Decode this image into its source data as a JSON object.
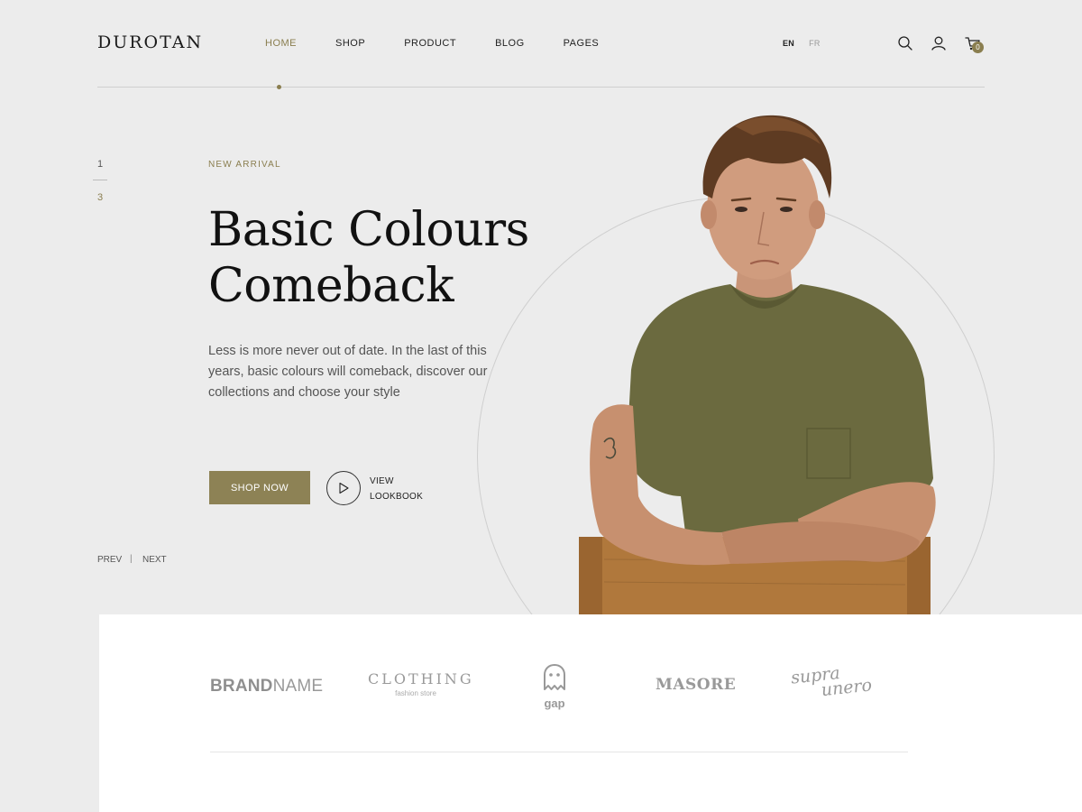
{
  "header": {
    "logo": "DUROTAN",
    "nav": [
      {
        "label": "HOME",
        "active": true
      },
      {
        "label": "SHOP",
        "active": false
      },
      {
        "label": "PRODUCT",
        "active": false
      },
      {
        "label": "BLOG",
        "active": false
      },
      {
        "label": "PAGES",
        "active": false
      }
    ],
    "languages": [
      "EN",
      "FR"
    ],
    "active_language": "EN",
    "icons": [
      "search-icon",
      "user-icon",
      "cart-icon"
    ],
    "cart_count": "0"
  },
  "slider": {
    "current": "1",
    "total": "3",
    "prev_label": "PREV",
    "separator": "|",
    "next_label": "NEXT"
  },
  "hero": {
    "eyebrow": "NEW ARRIVAL",
    "headline_line1": "Basic Colours",
    "headline_line2": "Comeback",
    "description": "Less is more never out of date. In the last of this years, basic colours will comeback, discover our collections and choose your style",
    "cta_label": "SHOP NOW",
    "lookbook_line1": "VIEW",
    "lookbook_line2": "LOOKBOOK"
  },
  "brands": {
    "brand1_bold": "BRAND",
    "brand1_light": "NAME",
    "brand2_name": "CLOTHING",
    "brand2_sub": "fashion store",
    "brand3_name": "gap",
    "brand4_name": "MASORE",
    "brand5_line1": "supra",
    "brand5_line2": "unero"
  },
  "colors": {
    "accent": "#8a7e4f",
    "background": "#ececec",
    "shirt": "#6b6a3f",
    "chair": "#b0783c"
  }
}
